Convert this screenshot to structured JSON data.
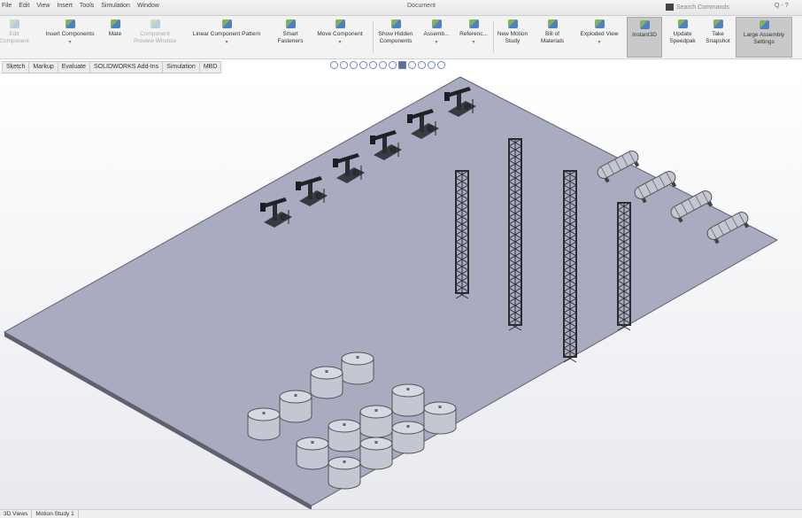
{
  "menubar": {
    "items": [
      "File",
      "Edit",
      "View",
      "Insert",
      "Tools",
      "Simulation",
      "Window"
    ],
    "doc_title": "Document",
    "search_placeholder": "Search Commands",
    "search_tail": "Q - ?"
  },
  "ribbon": {
    "edit_component": "Edit\nComponent",
    "insert_components": "Insert Components",
    "mate": "Mate",
    "component_preview": "Component\nPreview Window",
    "linear_pattern": "Linear Component Pattern",
    "smart_fasteners": "Smart\nFasteners",
    "move_component": "Move Component",
    "show_hidden": "Show Hidden\nComponents",
    "assembly_features": "Assemb...",
    "reference_geometry": "Referenc...",
    "new_motion_study": "New Motion\nStudy",
    "bill_of_materials": "Bill of\nMaterials",
    "exploded_view": "Exploded View",
    "instant3d": "Instant3D",
    "update_speedpak": "Update\nSpeedpak",
    "take_snapshot": "Take\nSnapshot",
    "large_assembly": "Large Assembly\nSettings",
    "dropdown_glyph": "▾"
  },
  "tabs": [
    "Sketch",
    "Markup",
    "Evaluate",
    "SOLIDWORKS Add-Ins",
    "Simulation",
    "MBD"
  ],
  "statusbar": {
    "tabs": [
      "3D Views",
      "Motion Study 1"
    ]
  },
  "colors": {
    "plate_top": "#a9abc0",
    "plate_edge": "#5f6170",
    "tower": "#2b2d33",
    "cylinder": "#c4c6d2",
    "active_button": "#c9c9c9"
  }
}
